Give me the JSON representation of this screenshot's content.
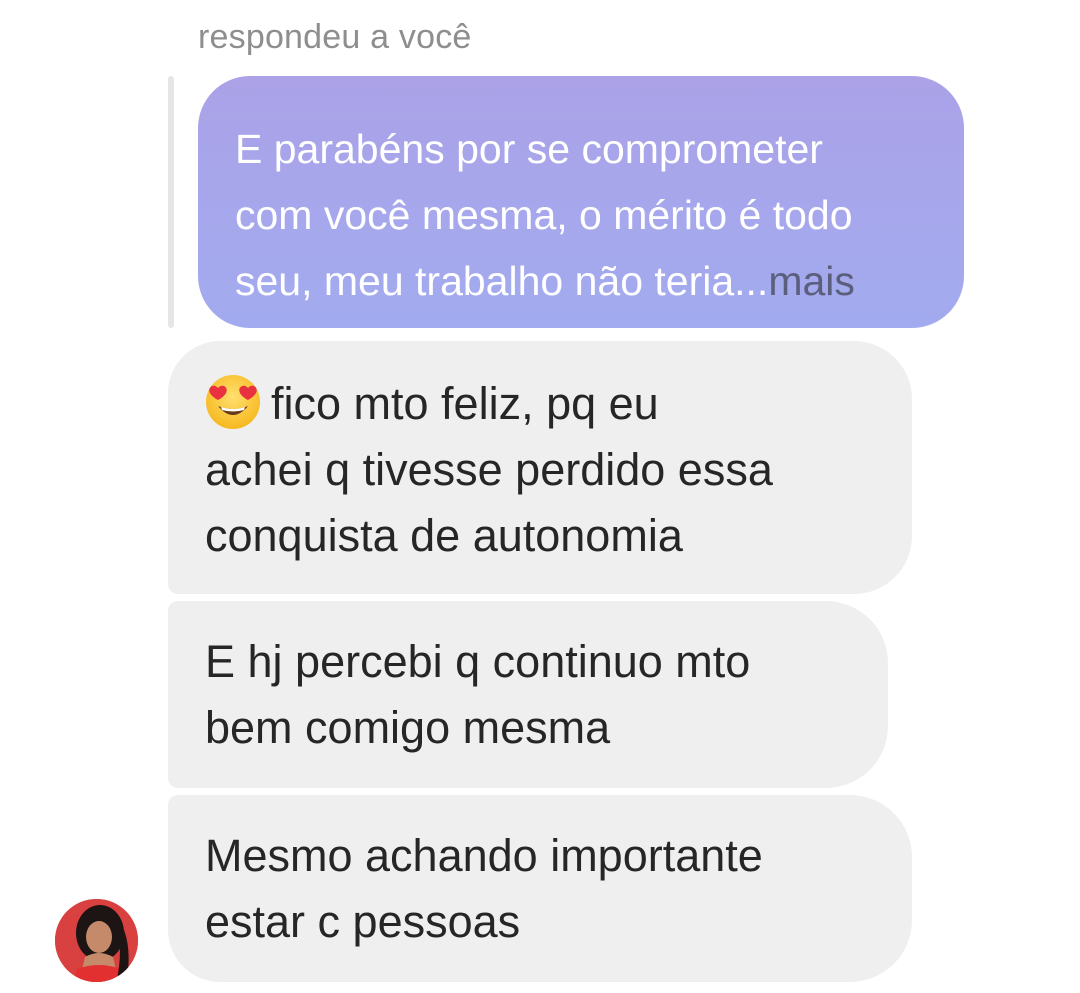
{
  "reply_header": "respondeu a você",
  "quoted_message": {
    "lines": [
      "E parabéns por se comprometer",
      "com você mesma, o mérito é todo",
      "seu, meu trabalho não teria..."
    ],
    "more_label": "mais"
  },
  "messages": [
    {
      "emoji": "smiling-face-with-heart-eyes-icon",
      "lines": [
        "fico mto feliz, pq eu",
        "achei q tivesse perdido essa",
        "conquista de autonomia"
      ]
    },
    {
      "lines": [
        "E hj percebi q continuo mto",
        "bem comigo mesma"
      ]
    },
    {
      "lines": [
        "Mesmo achando importante",
        "estar c pessoas"
      ]
    }
  ],
  "colors": {
    "quoted_bubble_top": "#aba2e8",
    "quoted_bubble_bottom": "#a2abef",
    "received_bubble": "#efefef",
    "text_dark": "#262626",
    "header_gray": "#8e8e8e"
  }
}
